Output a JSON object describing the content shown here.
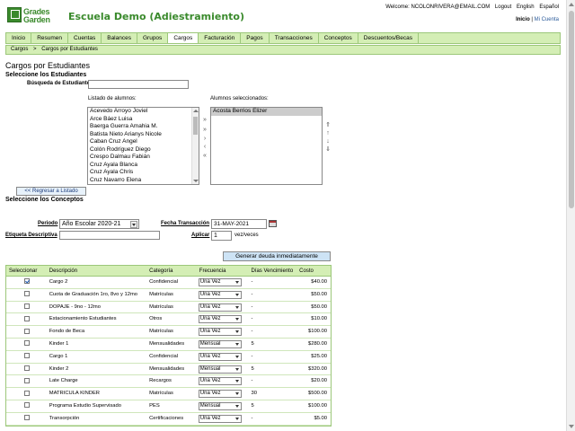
{
  "header": {
    "logo_line1": "Grades",
    "logo_line2": "Garden",
    "school_name": "Escuela Demo (Adiestramiento)",
    "welcome": "Welcome: NCOLONRIVERA@EMAIL.COM",
    "logout": "Logout",
    "lang_en": "English",
    "lang_es": "Español",
    "inicio": "Inicio",
    "separator": "|",
    "mi_cuenta": "Mi Cuenta"
  },
  "nav": [
    "Inicio",
    "Resumen",
    "Cuentas",
    "Balances",
    "Grupos",
    "Cargos",
    "Facturación",
    "Pagos",
    "Transacciones",
    "Conceptos",
    "Descuentos/Becas"
  ],
  "breadcrumb": [
    "Cargos",
    ">",
    "Cargos por Estudiantes"
  ],
  "page": {
    "title": "Cargos por Estudiantes",
    "select_students": "Seleccione los Estudiantes",
    "search_label": "Búsqueda de Estudiante",
    "search_value": "",
    "list_left_label": "Listado de alumnos:",
    "list_right_label": "Alumnos seleccionados:",
    "back_button": "<< Regresar a Listado",
    "select_concepts": "Seleccione los Conceptos",
    "periodo_label": "Periodo",
    "periodo_value": "Año Escolar 2020-21",
    "fecha_label": "Fecha Transacción",
    "fecha_value": "31-MAY-2021",
    "etiqueta_label": "Etiqueta Descriptiva",
    "etiqueta_value": "",
    "aplicar_label": "Aplicar",
    "aplicar_value": "1",
    "aplicar_suffix": "vez/veces",
    "generate_button": "Generar deuda inmediatamente"
  },
  "students_available": [
    "Acevedo Arroyo Joviel",
    "Arce Báez Luisa",
    "Baerga Guerra Amahia M.",
    "Batista Nieto Arianys Nicole",
    "Caban Cruz Angel",
    "Colón Rodríguez Diego",
    "Crespo Dalmau Fabián",
    "Cruz Ayala Blanca",
    "Cruz Ayala Chris",
    "Cruz Navarro Elena"
  ],
  "students_selected": [
    "Acosta Berrios Elizer"
  ],
  "table": {
    "headers": [
      "Seleccionar",
      "Descripción",
      "Categoría",
      "Frecuencia",
      "Días Vencimiento",
      "Costo"
    ],
    "rows": [
      {
        "checked": true,
        "desc": "Cargo 2",
        "cat": "Confidencial",
        "freq": "Una Vez",
        "dias": "-",
        "costo": "$40.00"
      },
      {
        "checked": false,
        "desc": "Cuota de Graduación 1ro, 8vo y 12mo",
        "cat": "Matrículas",
        "freq": "Una Vez",
        "dias": "-",
        "costo": "$50.00"
      },
      {
        "checked": false,
        "desc": "DOPAJE - 9no - 12mo",
        "cat": "Matrículas",
        "freq": "Una Vez",
        "dias": "-",
        "costo": "$50.00"
      },
      {
        "checked": false,
        "desc": "Estacionamiento Estudiantes",
        "cat": "Otros",
        "freq": "Una Vez",
        "dias": "-",
        "costo": "$10.00"
      },
      {
        "checked": false,
        "desc": "Fondo de Beca",
        "cat": "Matrículas",
        "freq": "Una Vez",
        "dias": "-",
        "costo": "$100.00"
      },
      {
        "checked": false,
        "desc": "Kinder 1",
        "cat": "Mensualidades",
        "freq": "Mensual",
        "dias": "5",
        "costo": "$280.00"
      },
      {
        "checked": false,
        "desc": "Cargo 1",
        "cat": "Confidencial",
        "freq": "Una Vez",
        "dias": "-",
        "costo": "$25.00"
      },
      {
        "checked": false,
        "desc": "Kinder 2",
        "cat": "Mensualidades",
        "freq": "Mensual",
        "dias": "5",
        "costo": "$320.00"
      },
      {
        "checked": false,
        "desc": "Late Charge",
        "cat": "Recargos",
        "freq": "Una Vez",
        "dias": "-",
        "costo": "$20.00"
      },
      {
        "checked": false,
        "desc": "MATRICULA KINDER",
        "cat": "Matrículas",
        "freq": "Una Vez",
        "dias": "30",
        "costo": "$500.00"
      },
      {
        "checked": false,
        "desc": "Programa Estudio Supervisado",
        "cat": "PES",
        "freq": "Mensual",
        "dias": "5",
        "costo": "$100.00"
      },
      {
        "checked": false,
        "desc": "Transorpción",
        "cat": "Certificaciones",
        "freq": "Una Vez",
        "dias": "-",
        "costo": "$5.00"
      }
    ]
  }
}
